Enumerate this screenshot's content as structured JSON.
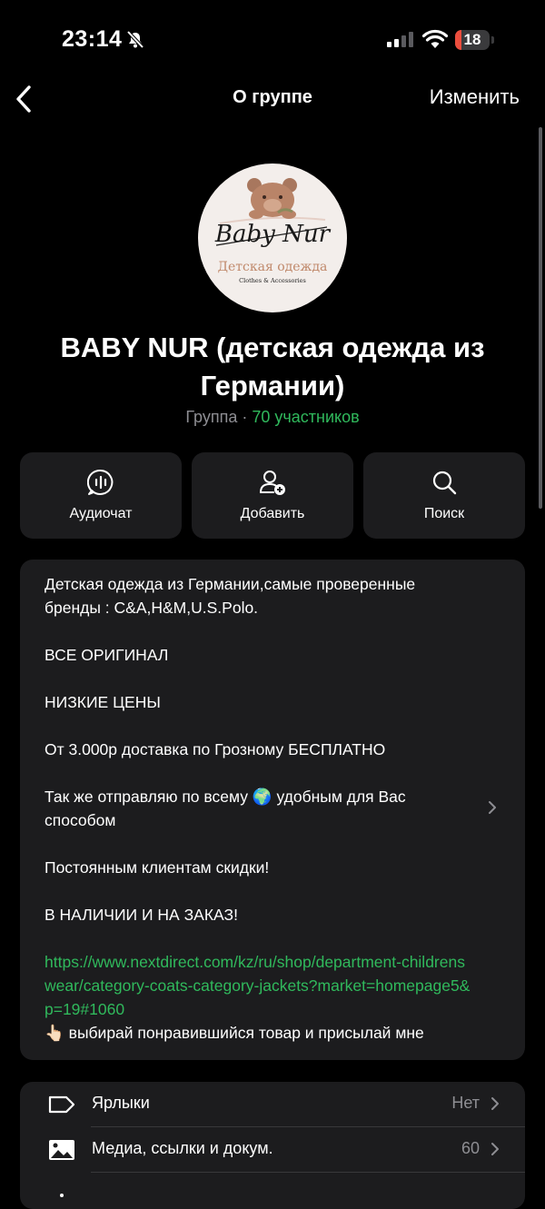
{
  "status_bar": {
    "time": "23:14",
    "battery": "18",
    "battery_level": 0.18
  },
  "nav": {
    "title": "О группе",
    "edit_label": "Изменить"
  },
  "group": {
    "logo_script": "Baby Nur",
    "logo_subtitle": "Детская одежда",
    "logo_tagline": "Clothes & Accessories",
    "name": "BABY NUR (детская одежда из Германии)",
    "type": "Группа",
    "separator": " · ",
    "members": "70 участников"
  },
  "actions": [
    {
      "label": "Аудиочат",
      "icon": "audio-chat-icon"
    },
    {
      "label": "Добавить",
      "icon": "add-user-icon"
    },
    {
      "label": "Поиск",
      "icon": "search-icon"
    }
  ],
  "description": {
    "line1": "Детская одежда из Германии,самые проверенные бренды : C&A,H&M,U.S.Polo.",
    "line2": "ВСЕ ОРИГИНАЛ",
    "line3": "НИЗКИЕ ЦЕНЫ",
    "line4": "От 3.000р доставка по Грозному БЕСПЛАТНО",
    "line5": "Так же отправляю по всему 🌍 удобным для Вас способом",
    "line6": "Постоянным клиентам скидки!",
    "line7": "В НАЛИЧИИ И НА ЗАКАЗ!",
    "link": "https://www.nextdirect.com/kz/ru/shop/department-childrenswear/category-coats-category-jackets?market=homepage5&p=19#1060",
    "line8": "👆🏻 выбирай понравившийся товар и присылай мне"
  },
  "settings": [
    {
      "label": "Ярлыки",
      "value": "Нет",
      "icon": "tag-icon"
    },
    {
      "label": "Медиа, ссылки и докум.",
      "value": "60",
      "icon": "image-icon"
    }
  ],
  "colors": {
    "accent_green": "#30b95c",
    "card": "#1c1c1e",
    "secondary_text": "#8e8e93"
  }
}
